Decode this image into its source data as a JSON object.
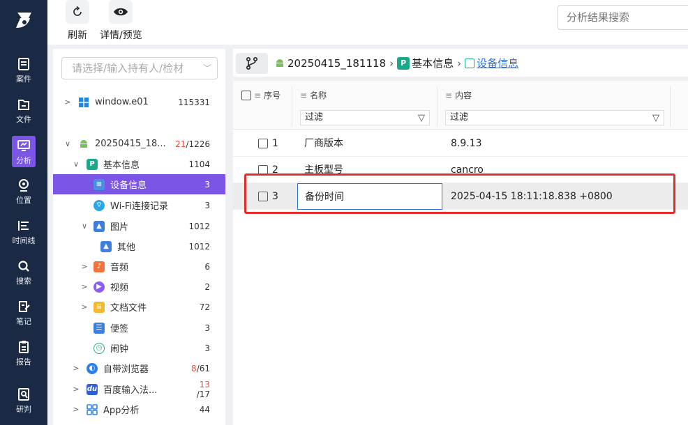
{
  "nav": {
    "items": [
      {
        "id": "case",
        "label": "案件",
        "icon": "case-icon"
      },
      {
        "id": "file",
        "label": "文件",
        "icon": "folder-icon"
      },
      {
        "id": "analysis",
        "label": "分析",
        "icon": "monitor-icon",
        "active": true
      },
      {
        "id": "location",
        "label": "位置",
        "icon": "location-icon"
      },
      {
        "id": "timeline",
        "label": "时间线",
        "icon": "timeline-icon"
      },
      {
        "id": "search",
        "label": "搜索",
        "icon": "search-icon"
      },
      {
        "id": "notes",
        "label": "笔记",
        "icon": "note-icon"
      },
      {
        "id": "report",
        "label": "报告",
        "icon": "report-icon"
      },
      {
        "id": "judge",
        "label": "研判",
        "icon": "judge-icon"
      }
    ]
  },
  "toolbar": {
    "refresh_label": "刷新",
    "preview_label": "详情/预览",
    "search_placeholder": "分析结果搜索"
  },
  "tree": {
    "select_placeholder": "请选择/输入持有人/检材",
    "items": [
      {
        "label": "window.e01",
        "count": "115331",
        "icon": "windows-icon"
      },
      {
        "label": "20250415_18...",
        "count_red": "21",
        "count": "/1226",
        "icon": "android-icon"
      },
      {
        "label": "基本信息",
        "count": "1104",
        "icon": "basic-info-icon"
      },
      {
        "label": "设备信息",
        "count": "3",
        "icon": "device-info-icon"
      },
      {
        "label": "Wi-Fi连接记录",
        "count": "3",
        "icon": "wifi-icon"
      },
      {
        "label": "图片",
        "count": "1012",
        "icon": "image-icon"
      },
      {
        "label": "其他",
        "count": "1012",
        "icon": "image-icon"
      },
      {
        "label": "音频",
        "count": "6",
        "icon": "audio-icon"
      },
      {
        "label": "视频",
        "count": "2",
        "icon": "video-icon"
      },
      {
        "label": "文档文件",
        "count": "72",
        "icon": "document-icon"
      },
      {
        "label": "便签",
        "count": "3",
        "icon": "memo-icon"
      },
      {
        "label": "闹钟",
        "count": "3",
        "icon": "clock-icon"
      },
      {
        "label": "自带浏览器",
        "count_red": "8",
        "count": "/61",
        "icon": "browser-icon"
      },
      {
        "label": "百度输入法...",
        "count_red": "13",
        "count": "/17",
        "icon": "baidu-icon"
      },
      {
        "label": "App分析",
        "count": "44",
        "icon": "apps-icon"
      }
    ]
  },
  "breadcrumb": {
    "device": "20250415_181118",
    "section": "基本信息",
    "current": "设备信息"
  },
  "grid": {
    "headers": {
      "index": "序号",
      "name": "名称",
      "content": "内容"
    },
    "filter_label": "过滤",
    "rows": [
      {
        "index": "1",
        "name": "厂商版本",
        "content": "8.9.13"
      },
      {
        "index": "2",
        "name": "主板型号",
        "content": "cancro"
      },
      {
        "index": "3",
        "name": "备份时间",
        "content": "2025-04-15 18:11:18.838 +0800"
      }
    ]
  }
}
